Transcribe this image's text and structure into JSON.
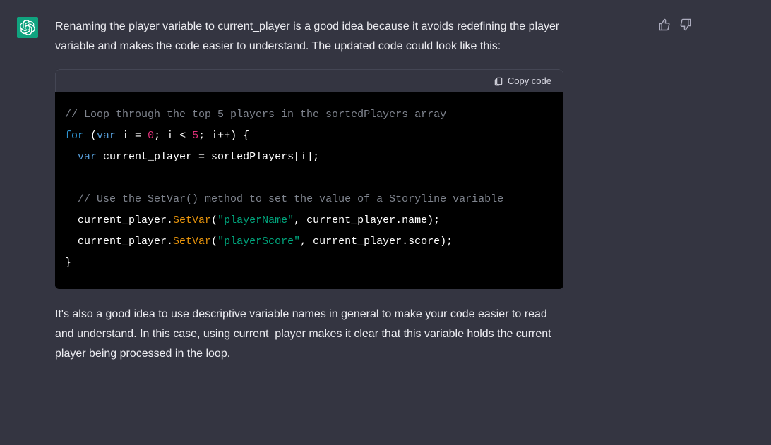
{
  "message": {
    "intro": "Renaming the player variable to current_player is a good idea because it avoids redefining the player variable and makes the code easier to understand. The updated code could look like this:",
    "outro": "It's also a good idea to use descriptive variable names in general to make your code easier to read and understand. In this case, using current_player makes it clear that this variable holds the current player being processed in the loop."
  },
  "codeblock": {
    "copy_label": "Copy code",
    "language": "javascript",
    "tokens": [
      [
        {
          "t": "comment",
          "v": "// Loop through the top 5 players in the sortedPlayers array"
        }
      ],
      [
        {
          "t": "keyword",
          "v": "for"
        },
        {
          "t": "plain",
          "v": " ("
        },
        {
          "t": "keyword2",
          "v": "var"
        },
        {
          "t": "plain",
          "v": " i = "
        },
        {
          "t": "num",
          "v": "0"
        },
        {
          "t": "plain",
          "v": "; i < "
        },
        {
          "t": "num",
          "v": "5"
        },
        {
          "t": "plain",
          "v": "; i++) {"
        }
      ],
      [
        {
          "t": "plain",
          "v": "  "
        },
        {
          "t": "keyword2",
          "v": "var"
        },
        {
          "t": "plain",
          "v": " current_player = sortedPlayers[i];"
        }
      ],
      [],
      [
        {
          "t": "plain",
          "v": "  "
        },
        {
          "t": "comment",
          "v": "// Use the SetVar() method to set the value of a Storyline variable"
        }
      ],
      [
        {
          "t": "plain",
          "v": "  current_player."
        },
        {
          "t": "func",
          "v": "SetVar"
        },
        {
          "t": "plain",
          "v": "("
        },
        {
          "t": "str",
          "v": "\"playerName\""
        },
        {
          "t": "plain",
          "v": ", current_player.name);"
        }
      ],
      [
        {
          "t": "plain",
          "v": "  current_player."
        },
        {
          "t": "func",
          "v": "SetVar"
        },
        {
          "t": "plain",
          "v": "("
        },
        {
          "t": "str",
          "v": "\"playerScore\""
        },
        {
          "t": "plain",
          "v": ", current_player.score);"
        }
      ],
      [
        {
          "t": "plain",
          "v": "}"
        }
      ]
    ]
  },
  "icons": {
    "avatar": "openai-logo",
    "thumbs_up": "thumbs-up-icon",
    "thumbs_down": "thumbs-down-icon",
    "clipboard": "clipboard-icon"
  }
}
